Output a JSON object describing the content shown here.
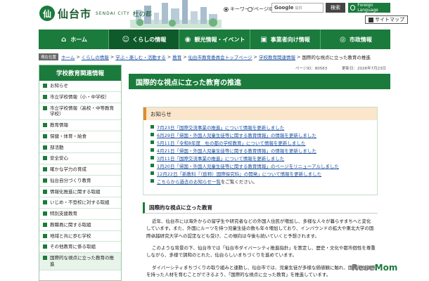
{
  "header": {
    "logo_name": "仙台市",
    "logo_sub": "SENDAI CITY",
    "logo_tag": "杜の都",
    "radio_keyword": "キーワード",
    "radio_pageid": "ページID",
    "search_brand": "Google",
    "search_brand_sub": "提供",
    "search_button": "検索",
    "foreign_language": "Foreign Language",
    "sitemap": "サイトマップ"
  },
  "gnav": {
    "items": [
      {
        "label": "ホーム",
        "icon": "home-icon"
      },
      {
        "label": "くらしの情報",
        "icon": "family-icon"
      },
      {
        "label": "観光情報・イベント",
        "icon": "camera-icon"
      },
      {
        "label": "事業者向け情報",
        "icon": "briefcase-icon"
      },
      {
        "label": "市政情報",
        "icon": "city-icon"
      }
    ]
  },
  "breadcrumb": {
    "tag": "現在位置",
    "items": [
      "ホーム",
      "くらしの情報",
      "学ぶ・楽しむ・活動する",
      "教育",
      "仙台市教育委員会トップページ",
      "学校教育関連情報"
    ],
    "current": "国際的な視点に立った教育の推進"
  },
  "sidebar": {
    "title": "学校教育関連情報",
    "items": [
      "お知らせ",
      "市立学校情報（小・中学校）",
      "市立学校情報（高校・中等教育学校）",
      "教育情報",
      "保健・体育・給食",
      "部活動",
      "安全安心",
      "確かな学力の育成",
      "仙台自分づくり教育",
      "情報化推進に関する取組",
      "いじめ・不登校に対する取組",
      "特別支援教育",
      "教職員に関する取組",
      "地域と共に歩む学校",
      "その他教育に係る取組",
      "国際的な視点に立った教育の推進"
    ]
  },
  "page": {
    "page_id": "ページID：80563",
    "updated": "更新日：2026年7月23日",
    "title": "国際的な視点に立った教育の推進"
  },
  "notice": {
    "heading": "お知らせ",
    "items": [
      {
        "link": "7月23日「国際交流事業の推進」について情報を更新しました",
        "tail": ""
      },
      {
        "link": "6月29日「帰国・外国人児童生徒等に関する教育情報」の情報を更新しました",
        "tail": ""
      },
      {
        "link": "5月11日「令和8年度　杜の都の学校教育」について情報を更新しました",
        "tail": ""
      },
      {
        "link": "4月21日「帰国・外国人児童生徒等に関する教育情報」の情報を更新しました",
        "tail": ""
      },
      {
        "link": "3月11日「国際交流事業の推進」について情報を更新しました",
        "tail": ""
      },
      {
        "link": "1月20日「帰国・外国人児童生徒等に関する教育情報」のページをリニューアルしました",
        "tail": ""
      },
      {
        "link": "12月22日「新教科『（仮称）国際探究科』の開発」について情報を更新しました",
        "tail": ""
      },
      {
        "link": "こちらから過去のお知らせ一覧",
        "tail": "をご覧ください。"
      }
    ]
  },
  "section": {
    "heading": "国際的な視点に立った教育",
    "paragraphs": [
      "近年、仙台市には海外からの留学生や研究者などの外国人住民が増加し、多様な人々が暮らすまちへと変化しています。また、外国にルーツを持つ児童生徒の数も年々増加しており、インバウンドの拡大や東北大学の国際卓越研究大学への認定なども受け、この傾向は今後も続いていくと予想されます。",
      "このような背景の下、仙台市では「仙台市ダイバーシティ推進指針」を策定し、歴史・文化や都市個性を尊重しながら、多様で調和のとれた、仙台らしいまちづくりを進めています。",
      "ダイバーシティまちづくりの取り組みと連動し、仙台市では、児童生徒が多様な価値観に触れ、国際的な視点を持った人材を育むことができるよう、「国際的な視点に立った教育」を推進しています。"
    ]
  },
  "watermark": {
    "text_r": "Rese",
    "text_m": "Mom"
  }
}
